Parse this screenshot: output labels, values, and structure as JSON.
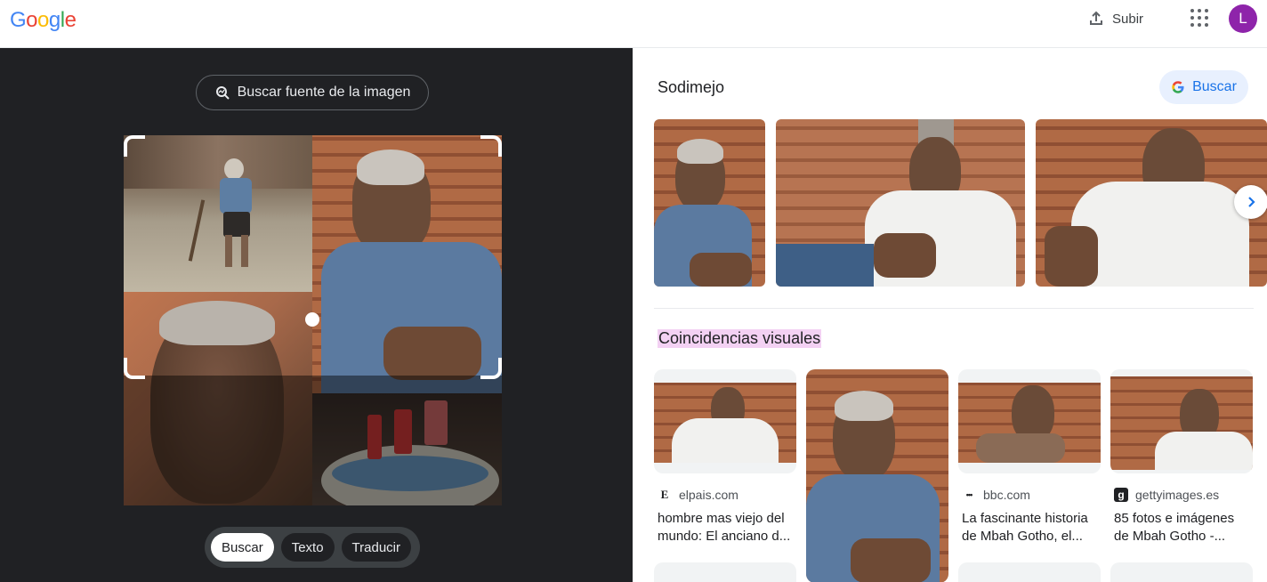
{
  "header": {
    "logo_letters": [
      {
        "ch": "G",
        "color": "#4285f4"
      },
      {
        "ch": "o",
        "color": "#ea4335"
      },
      {
        "ch": "o",
        "color": "#fbbc05"
      },
      {
        "ch": "g",
        "color": "#4285f4"
      },
      {
        "ch": "l",
        "color": "#34a853"
      },
      {
        "ch": "e",
        "color": "#ea4335"
      }
    ],
    "upload_label": "Subir",
    "upload_icon": "upload-icon",
    "apps_icon": "apps-grid-icon",
    "avatar_initial": "L",
    "avatar_color": "#8e24aa"
  },
  "lens": {
    "source_button_label": "Buscar fuente de la imagen",
    "source_icon": "image-search-icon",
    "modes": [
      {
        "label": "Buscar",
        "active": true
      },
      {
        "label": "Texto",
        "active": false
      },
      {
        "label": "Traducir",
        "active": false
      }
    ]
  },
  "results": {
    "similar_title": "Sodimejo",
    "search_button_label": "Buscar",
    "next_icon": "chevron-right-icon",
    "visual_matches_title": "Coincidencias visuales",
    "visual_matches": [
      {
        "site": "elpais.com",
        "favicon": "E",
        "title": "hombre mas viejo del mundo: El anciano d..."
      },
      {
        "site": "",
        "favicon": "",
        "title": ""
      },
      {
        "site": "bbc.com",
        "favicon": "•••",
        "title": "La fascinante historia de Mbah Gotho, el..."
      },
      {
        "site": "gettyimages.es",
        "favicon": "g",
        "title": "85 fotos e imágenes de Mbah Gotho -..."
      }
    ]
  }
}
